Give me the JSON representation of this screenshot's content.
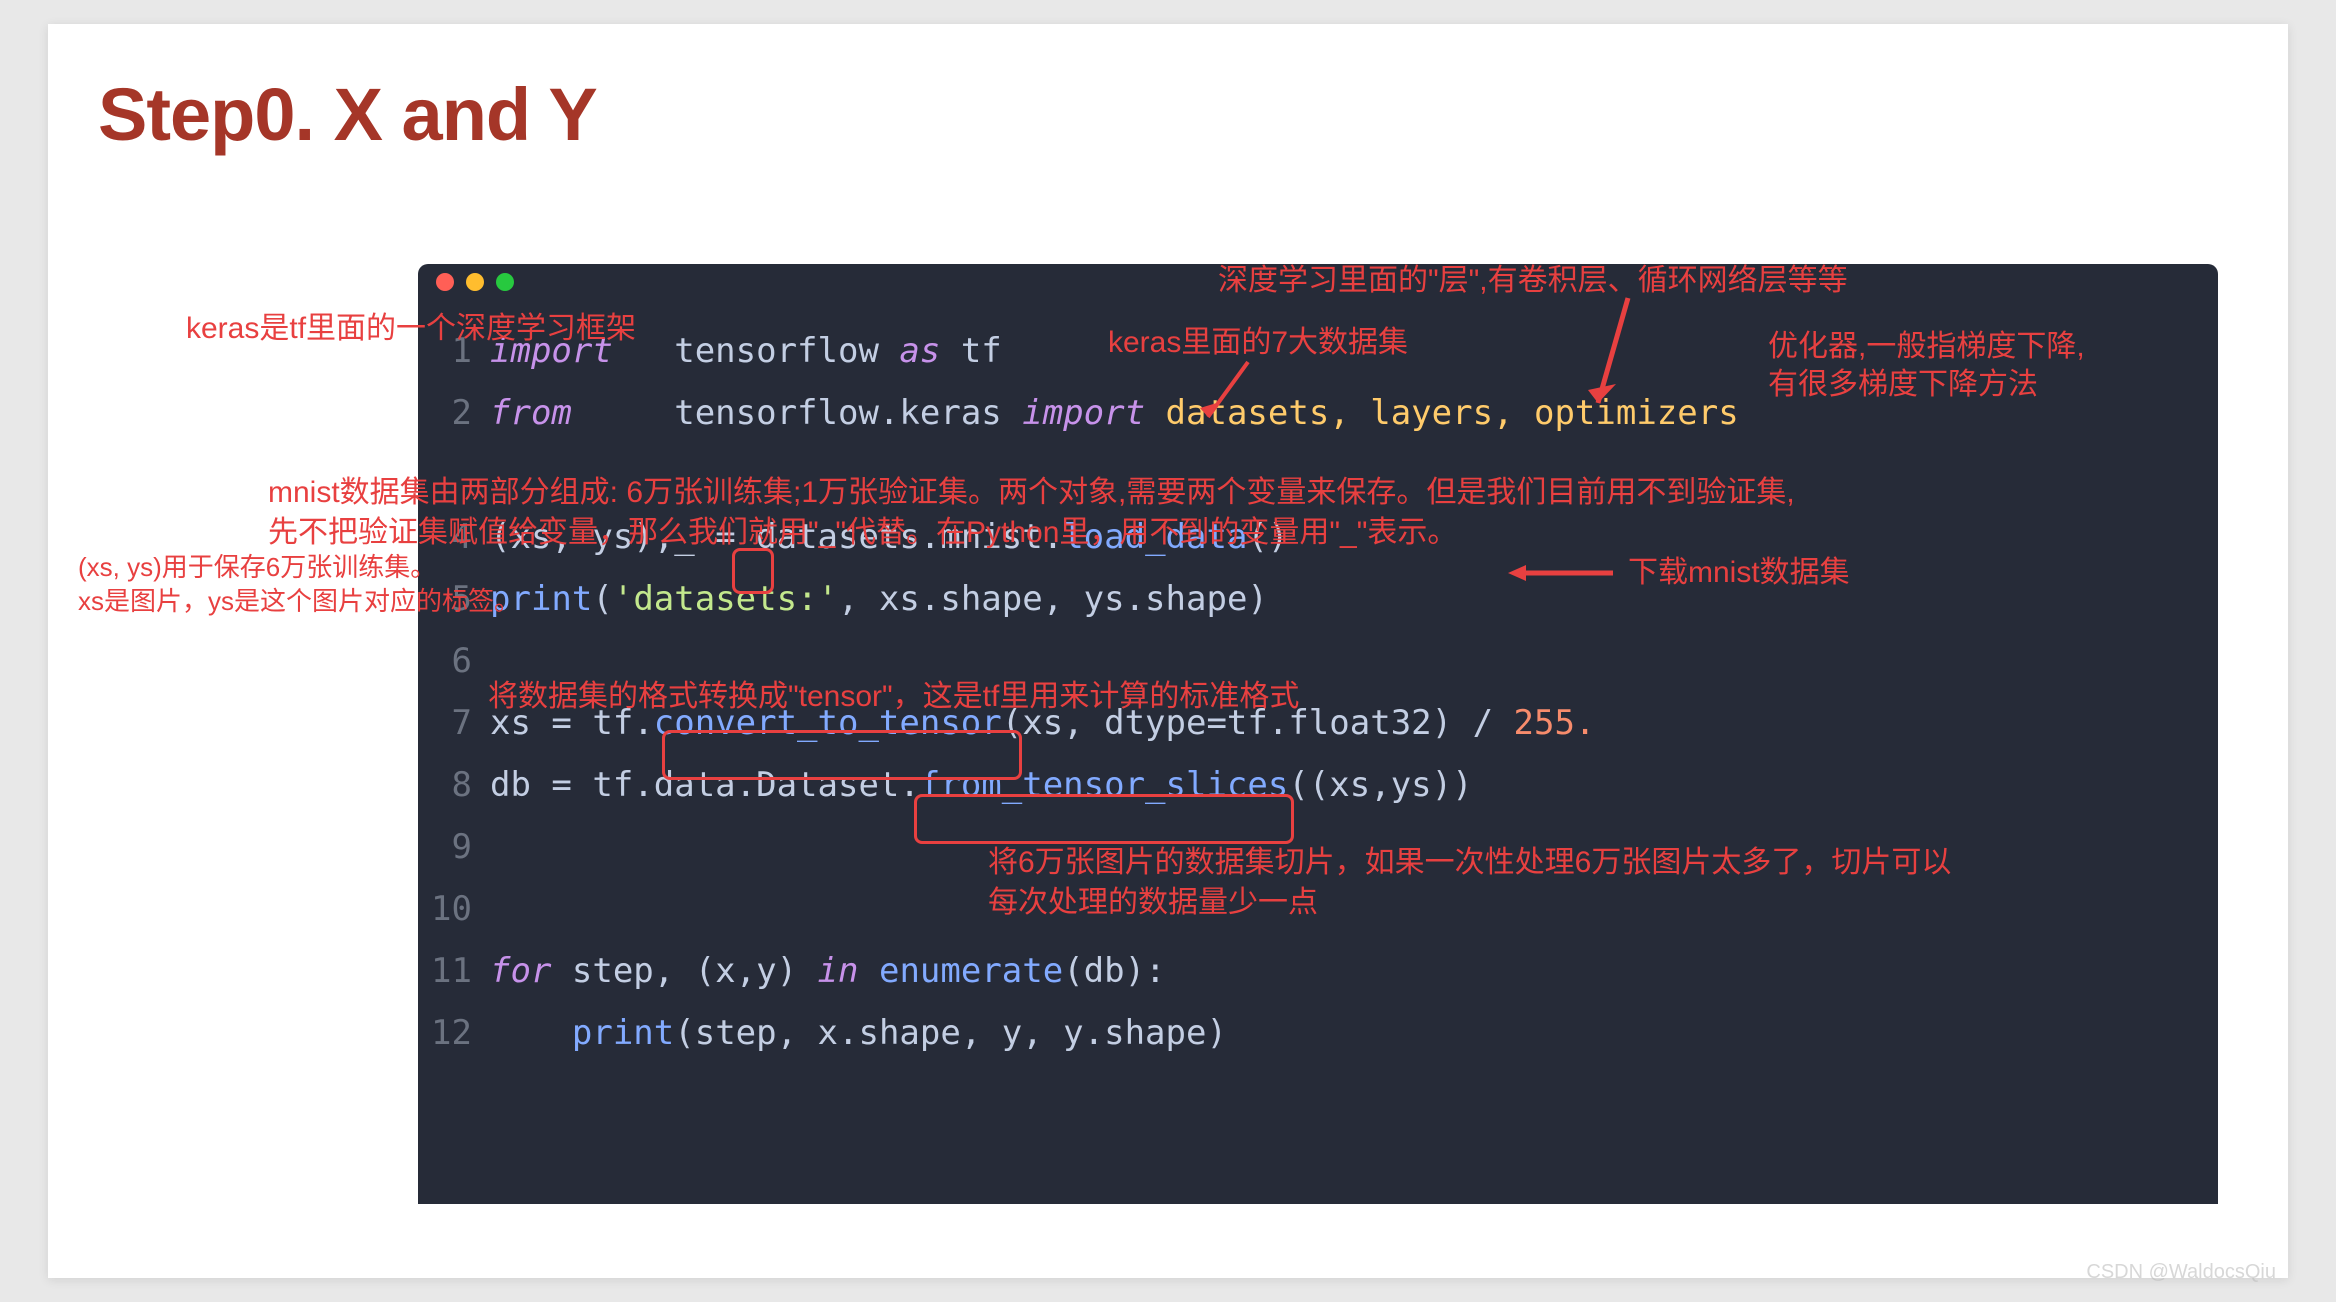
{
  "title": "Step0. X and Y",
  "code": {
    "l1_import": "import",
    "l1_rest": "   tensorflow ",
    "l1_as": "as",
    "l1_tf": " tf",
    "l2_from": "from",
    "l2_rest": "     tensorflow.keras ",
    "l2_import": "import",
    "l2_mods": " datasets, layers, optimizers",
    "l4_a": "(xs, ys),",
    "l4_u": "_",
    "l4_b": " = datasets.mnist.",
    "l4_fn": "load_data",
    "l4_c": "()",
    "l5_a": "print",
    "l5_b": "(",
    "l5_s": "'datasets:'",
    "l5_c": ", xs.shape, ys.shape)",
    "l7_a": "xs = tf.",
    "l7_fn": "convert_to_tensor",
    "l7_b": "(xs, dtype=tf.float32) / ",
    "l7_n": "255.",
    "l8_a": "db = tf.data.Dataset.",
    "l8_fn": "from_tensor_slices",
    "l8_b": "((xs,ys))",
    "l11_for": "for",
    "l11_a": " step, (x,y) ",
    "l11_in": "in",
    "l11_b": " ",
    "l11_fn": "enumerate",
    "l11_c": "(db):",
    "l12_a": "    ",
    "l12_p": "print",
    "l12_b": "(step, x.shape, y, y.shape)"
  },
  "ln": {
    "1": "1",
    "2": "2",
    "4": "4",
    "5": "5",
    "6": "6",
    "7": "7",
    "8": "8",
    "9": "9",
    "10": "10",
    "11": "11",
    "12": "12"
  },
  "annotations": {
    "keras_framework": "keras是tf里面的一个深度学习框架",
    "layers": "深度学习里面的\"层\",有卷积层、循环网络层等等",
    "datasets7": "keras里面的7大数据集",
    "optimizers": "优化器,一般指梯度下降,\n有很多梯度下降方法",
    "mnist_two_parts_1": "mnist数据集由两部分组成: 6万张训练集;1万张验证集。两个对象,需要两个变量来保存。但是我们目前用不到验证集,",
    "mnist_two_parts_2": "先不把验证集赋值给变量，那么我们就用\"_\"代替。在Python里，用不到的变量用\"_\"表示。",
    "xs_ys_1": "(xs, ys)用于保存6万张训练集。",
    "xs_ys_2": "xs是图片，ys是这个图片对应的标签。",
    "download_mnist": "下载mnist数据集",
    "to_tensor": "将数据集的格式转换成\"tensor\"，这是tf里用来计算的标准格式",
    "slice_1": "将6万张图片的数据集切片，如果一次性处理6万张图片太多了，切片可以",
    "slice_2": "每次处理的数据量少一点"
  },
  "watermark": "CSDN @WaldocsQiu"
}
